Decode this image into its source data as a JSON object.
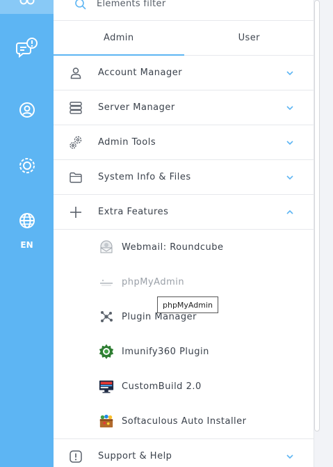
{
  "rail": {
    "language": "EN",
    "icons": [
      "top-icon",
      "chat-alert-icon",
      "user-circle-icon",
      "gear-icon",
      "globe-icon"
    ],
    "accent_color": "#5db5f3"
  },
  "filter": {
    "label": "Elements filter"
  },
  "tabs": [
    {
      "label": "Admin",
      "active": true
    },
    {
      "label": "User",
      "active": false
    }
  ],
  "sections": [
    {
      "label": "Account Manager",
      "icon": "user-icon",
      "expanded": false
    },
    {
      "label": "Server Manager",
      "icon": "server-icon",
      "expanded": false
    },
    {
      "label": "Admin Tools",
      "icon": "cogs-icon",
      "expanded": false
    },
    {
      "label": "System Info & Files",
      "icon": "folder-icon",
      "expanded": false
    },
    {
      "label": "Extra Features",
      "icon": "plus-icon",
      "expanded": true
    }
  ],
  "extra_features": [
    {
      "label": "Webmail: Roundcube",
      "icon": "roundcube-icon"
    },
    {
      "label": "phpMyAdmin",
      "icon": "phpmyadmin-icon"
    },
    {
      "label": "Plugin Manager",
      "icon": "plugin-icon"
    },
    {
      "label": "Imunify360 Plugin",
      "icon": "imunify-icon"
    },
    {
      "label": "CustomBuild 2.0",
      "icon": "custombuild-icon"
    },
    {
      "label": "Softaculous Auto Installer",
      "icon": "softaculous-icon"
    }
  ],
  "support": {
    "label": "Support & Help",
    "icon": "exclamation-icon"
  },
  "tooltip": {
    "text": "phpMyAdmin"
  }
}
